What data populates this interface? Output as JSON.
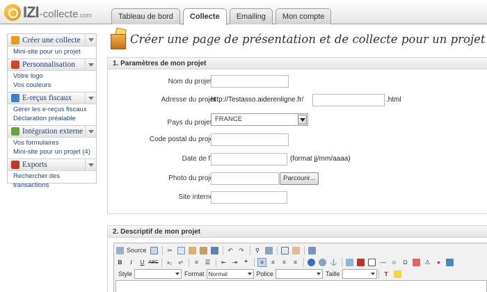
{
  "app": {
    "logo_main": "IZI",
    "logo_rest": "-collecte",
    "logo_suffix": ".com"
  },
  "tabs": [
    {
      "label": "Tableau de bord",
      "active": false
    },
    {
      "label": "Collecte",
      "active": true
    },
    {
      "label": "Emailing",
      "active": false
    },
    {
      "label": "Mon compte",
      "active": false
    }
  ],
  "sidebar": [
    {
      "title": "Créer une collecte",
      "icon_color": "#e59b22",
      "items": [
        "Mini-site pour un projet"
      ]
    },
    {
      "title": "Personnalisation",
      "icon_color": "#d2462f",
      "items": [
        "Votre logo",
        "Vos couleurs"
      ]
    },
    {
      "title": "E-reçus fiscaux",
      "icon_color": "#3f7fc9",
      "items": [
        "Gérer les e-reçus fiscaux",
        "Déclaration préalable"
      ]
    },
    {
      "title": "Intégration externe",
      "icon_color": "#6aa33d",
      "items": [
        "Vos formulaires",
        "Mini-site pour un projet (4)"
      ]
    },
    {
      "title": "Exports",
      "icon_color": "#c0392b",
      "items": [
        "Rechercher des transactions"
      ]
    }
  ],
  "page": {
    "title": "Créer une page de présentation et de collecte pour un projet"
  },
  "section1": {
    "heading": "1. Paramètres de mon projet",
    "fields": {
      "nom_label": "Nom du projet",
      "nom_value": "",
      "adresse_label": "Adresse du projet",
      "adresse_prefix": "http://Testasso.aiderenligne.fr/",
      "adresse_value": "",
      "adresse_suffix": ".html",
      "pays_label": "Pays du projet",
      "pays_value": "FRANCE",
      "cp_label": "Code postal du projet",
      "cp_value": "",
      "date_label": "Date de fin",
      "date_value": "",
      "date_hint": "(format jj/mm/aaaa)",
      "photo_label": "Photo du projet",
      "photo_value": "",
      "browse_label": "Parcourir...",
      "site_label": "Site internet",
      "site_value": "",
      "required_mark": "*"
    }
  },
  "section2": {
    "heading": "2. Descriptif de mon projet",
    "editor": {
      "source_label": "Source",
      "style_label": "Style",
      "style_value": "",
      "format_label": "Format",
      "format_value": "Normal",
      "font_label": "Police",
      "font_value": "",
      "size_label": "Taille",
      "size_value": ""
    }
  }
}
